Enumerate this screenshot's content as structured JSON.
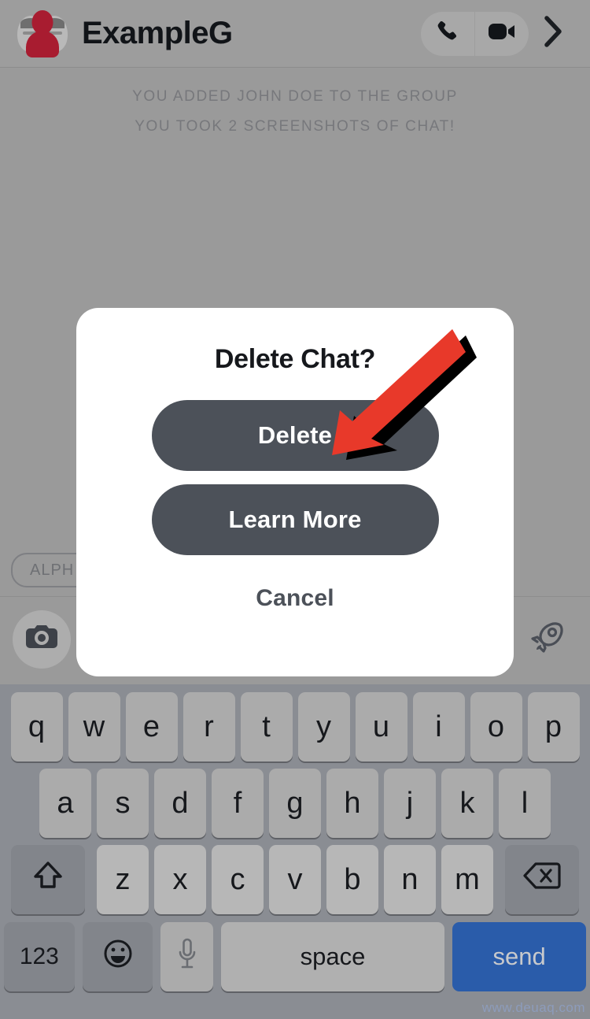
{
  "header": {
    "title": "ExampleG",
    "avatar_icon": "group-avatar-icon",
    "call_icon": "phone-icon",
    "video_icon": "video-camera-icon",
    "chevron_icon": "chevron-right-icon"
  },
  "conversation": {
    "system_messages": [
      "YOU ADDED JOHN DOE TO THE GROUP",
      "YOU TOOK 2 SCREENSHOTS OF CHAT!"
    ]
  },
  "chips": {
    "alpha_label": "ALPH"
  },
  "input_bar": {
    "camera_icon": "camera-icon",
    "rocket_icon": "rocket-icon"
  },
  "modal": {
    "title": "Delete Chat?",
    "delete_label": "Delete",
    "learn_more_label": "Learn More",
    "cancel_label": "Cancel"
  },
  "annotation": {
    "arrow_icon": "red-arrow-pointer",
    "arrow_color": "#e8392a",
    "shadow_color": "#000000",
    "points_at": "Delete"
  },
  "keyboard": {
    "row1": [
      "q",
      "w",
      "e",
      "r",
      "t",
      "y",
      "u",
      "i",
      "o",
      "p"
    ],
    "row2": [
      "a",
      "s",
      "d",
      "f",
      "g",
      "h",
      "j",
      "k",
      "l"
    ],
    "row3": [
      "z",
      "x",
      "c",
      "v",
      "b",
      "n",
      "m"
    ],
    "shift_icon": "shift-up-arrow-icon",
    "backspace_icon": "backspace-delete-icon",
    "numbers_label": "123",
    "emoji_icon": "smiley-face-icon",
    "mic_icon": "microphone-icon",
    "space_label": "space",
    "send_label": "send"
  },
  "watermark": {
    "text": "www.deuaq.com"
  },
  "colors": {
    "page_background": "#9a9a9a",
    "modal_background": "#ffffff",
    "button_slate": "#4c5159",
    "keyboard_background": "#8a8d93",
    "key_gray": "#ababab",
    "send_blue": "#2a5caa",
    "accent_red": "#e8392a",
    "avatar_red": "#a81c30"
  }
}
